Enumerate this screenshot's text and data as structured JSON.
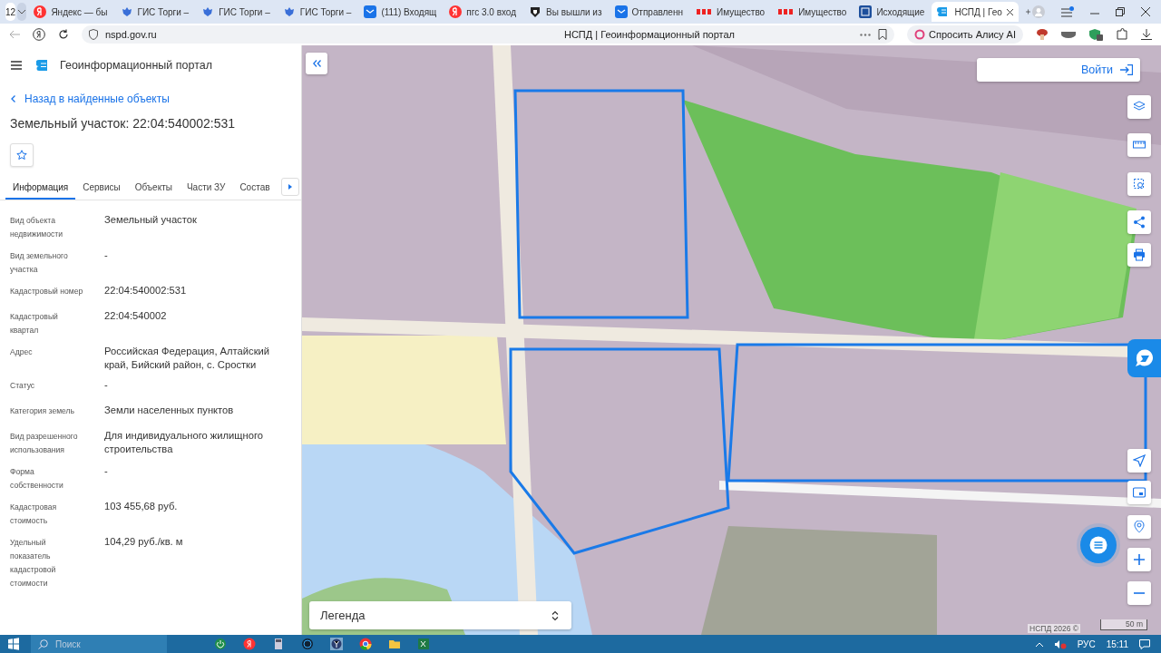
{
  "browser": {
    "tab_count": "12",
    "tabs": [
      {
        "kind": "yandex",
        "title": "Яндекс — бы",
        "selected": false
      },
      {
        "kind": "gis",
        "title": "ГИС Торги –",
        "selected": false
      },
      {
        "kind": "gis",
        "title": "ГИС Торги –",
        "selected": false
      },
      {
        "kind": "gis",
        "title": "ГИС Торги –",
        "selected": false
      },
      {
        "kind": "mail",
        "title": "(111) Входящ",
        "selected": false
      },
      {
        "kind": "yandex",
        "title": "пгс 3.0 вход",
        "selected": false
      },
      {
        "kind": "shield",
        "title": "Вы вышли из",
        "selected": false
      },
      {
        "kind": "mail",
        "title": "Отправленн",
        "selected": false
      },
      {
        "kind": "rts",
        "title": "Имущество",
        "selected": false
      },
      {
        "kind": "rts",
        "title": "Имущество",
        "selected": false
      },
      {
        "kind": "doc",
        "title": "Исходящие",
        "selected": false
      },
      {
        "kind": "nspd",
        "title": "НСПД | Гео",
        "selected": true
      }
    ],
    "url": "nspd.gov.ru",
    "page_title": "НСПД | Геоинформационный портал",
    "alice_button": "Спросить Алису AI"
  },
  "portal": {
    "title": "Геоинформационный портал",
    "back_link": "Назад в найденные объекты",
    "heading": "Земельный участок: 22:04:540002:531",
    "tabs": [
      {
        "label": "Информация",
        "selected": true
      },
      {
        "label": "Сервисы",
        "selected": false
      },
      {
        "label": "Объекты",
        "selected": false
      },
      {
        "label": "Части ЗУ",
        "selected": false
      },
      {
        "label": "Состав",
        "selected": false
      }
    ],
    "fields": [
      {
        "label": "Вид объекта недвижимости",
        "value": "Земельный участок"
      },
      {
        "label": "Вид земельного участка",
        "value": "-"
      },
      {
        "label": "Кадастровый номер",
        "value": "22:04:540002:531"
      },
      {
        "label": "Кадастровый квартал",
        "value": "22:04:540002"
      },
      {
        "label": "Адрес",
        "value": "Российская Федерация, Алтайский край, Бийский район, с. Сростки"
      },
      {
        "label": "Статус",
        "value": "-"
      },
      {
        "label": "Категория земель",
        "value": "Земли населенных пунктов"
      },
      {
        "label": "Вид разрешенного использования",
        "value": "Для индивидуального жилищного строительства"
      },
      {
        "label": "Форма собственности",
        "value": "-"
      },
      {
        "label": "Кадастровая стоимость",
        "value": "103 455,68 руб."
      },
      {
        "label": "Удельный показатель кадастровой стоимости",
        "value": "104,29 руб./кв. м"
      }
    ]
  },
  "map": {
    "login_button": "Войти",
    "legend": "Легенда",
    "attribution": "НСПД 2026 ©",
    "scale": "50 m"
  },
  "taskbar": {
    "search_placeholder": "Поиск",
    "language": "РУС",
    "time": "15:11"
  }
}
